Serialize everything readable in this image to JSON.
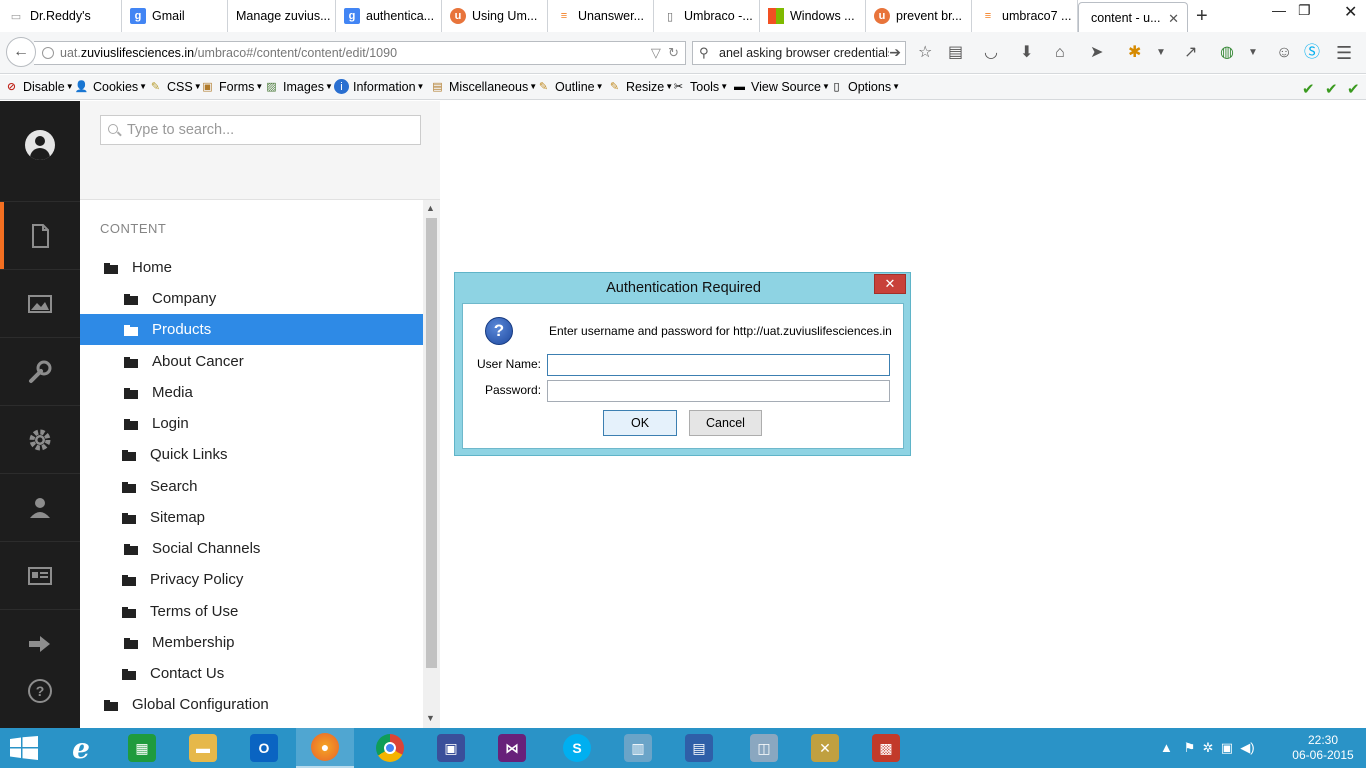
{
  "browser": {
    "tabs": [
      {
        "label": "Dr.Reddy's",
        "icon": "page-icon",
        "color": "#999999"
      },
      {
        "label": "Gmail",
        "icon": "google-icon",
        "color": "#4285f4"
      },
      {
        "label": "Manage zuvius...",
        "icon": "page-icon",
        "color": "#999999"
      },
      {
        "label": "authentica...",
        "icon": "google-icon",
        "color": "#4285f4"
      },
      {
        "label": "Using Um...",
        "icon": "umbraco-icon",
        "color": "#e8743b"
      },
      {
        "label": "Unanswer...",
        "icon": "stackoverflow-icon",
        "color": "#f48024"
      },
      {
        "label": "Umbraco -...",
        "icon": "doc-icon",
        "color": "#666666"
      },
      {
        "label": "Windows ...",
        "icon": "windows-icon",
        "color": "#00a4ef"
      },
      {
        "label": "prevent br...",
        "icon": "umbraco-icon",
        "color": "#e8743b"
      },
      {
        "label": "umbraco7 ...",
        "icon": "stackoverflow-icon",
        "color": "#f48024"
      },
      {
        "label": "content - u...",
        "icon": "none",
        "color": "#ffffff",
        "active": true
      }
    ],
    "new_tab": "+",
    "url_prefix": "uat.",
    "url_domain": "zuviuslifesciences.in",
    "url_path": "/umbraco#/content/content/edit/1090",
    "search_text": "anel asking browser credentials"
  },
  "devtoolbar": {
    "items": [
      "Disable",
      "Cookies",
      "CSS",
      "Forms",
      "Images",
      "Information",
      "Miscellaneous",
      "Outline",
      "Resize",
      "Tools",
      "View Source",
      "Options"
    ]
  },
  "umbraco": {
    "search_placeholder": "Type to search...",
    "section_title": "CONTENT",
    "tree": [
      {
        "label": "Home",
        "level": 0
      },
      {
        "label": "Company",
        "level": 1
      },
      {
        "label": "Products",
        "level": 1,
        "selected": true
      },
      {
        "label": "About Cancer",
        "level": 1
      },
      {
        "label": "Media",
        "level": 1
      },
      {
        "label": "Login",
        "level": 1
      },
      {
        "label": "Quick Links",
        "level": 1
      },
      {
        "label": "Search",
        "level": 1
      },
      {
        "label": "Sitemap",
        "level": 1
      },
      {
        "label": "Social Channels",
        "level": 1
      },
      {
        "label": "Privacy Policy",
        "level": 1
      },
      {
        "label": "Terms of Use",
        "level": 1
      },
      {
        "label": "Membership",
        "level": 1
      },
      {
        "label": "Contact Us",
        "level": 1
      },
      {
        "label": "Global Configuration",
        "level": 0
      }
    ],
    "sections": [
      "content",
      "media",
      "settings",
      "developer",
      "users",
      "members",
      "forms-logout"
    ]
  },
  "dialog": {
    "title": "Authentication Required",
    "close": "✕",
    "message": "Enter username and password for http://uat.zuviuslifesciences.in",
    "username_label": "User Name:",
    "password_label": "Password:",
    "username_value": "",
    "password_value": "",
    "ok_label": "OK",
    "cancel_label": "Cancel"
  },
  "taskbar": {
    "time": "22:30",
    "date": "06-06-2015",
    "apps": [
      {
        "name": "internet-explorer",
        "color": "#1e7fd6",
        "glyph": "e"
      },
      {
        "name": "store",
        "color": "#1f9b3d",
        "glyph": "▦"
      },
      {
        "name": "file-explorer",
        "color": "#e6b84a",
        "glyph": "▬"
      },
      {
        "name": "outlook",
        "color": "#0a64c2",
        "glyph": "O"
      },
      {
        "name": "firefox",
        "color": "#e8632b",
        "glyph": "●"
      },
      {
        "name": "chrome",
        "color": "#3a9a3a",
        "glyph": "◉"
      },
      {
        "name": "sql-management",
        "color": "#3a4f9a",
        "glyph": "▣"
      },
      {
        "name": "visual-studio",
        "color": "#68217a",
        "glyph": "⋈"
      },
      {
        "name": "skype",
        "color": "#00aff0",
        "glyph": "S"
      },
      {
        "name": "iis-manager",
        "color": "#6aa4c8",
        "glyph": "▥"
      },
      {
        "name": "remote-desktop",
        "color": "#2f5fa8",
        "glyph": "▤"
      },
      {
        "name": "performance-monitor",
        "color": "#8aa7c0",
        "glyph": "◫"
      },
      {
        "name": "tools",
        "color": "#c0a040",
        "glyph": "✕"
      },
      {
        "name": "task-scheduler",
        "color": "#c23a2a",
        "glyph": "▩"
      }
    ]
  }
}
